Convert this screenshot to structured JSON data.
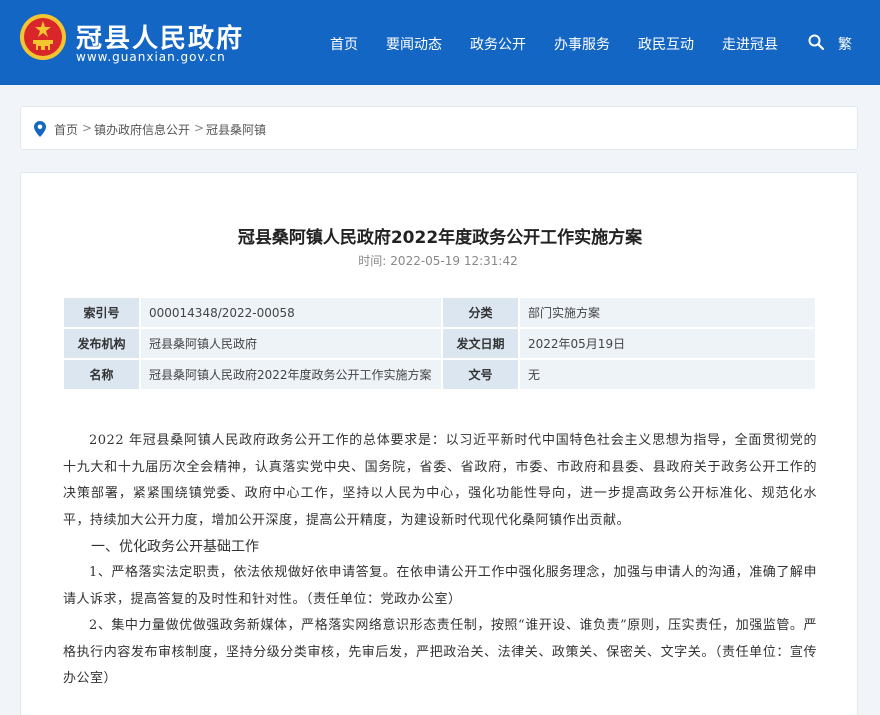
{
  "header": {
    "site_title": "冠县人民政府",
    "site_url": "www.guanxian.gov.cn",
    "nav": [
      "首页",
      "要闻动态",
      "政务公开",
      "办事服务",
      "政民互动",
      "走进冠县"
    ],
    "lang_switch": "繁"
  },
  "breadcrumb": {
    "items": [
      "首页",
      "镇办政府信息公开",
      "冠县桑阿镇"
    ],
    "separator": ">"
  },
  "article": {
    "title": "冠县桑阿镇人民政府2022年度政务公开工作实施方案",
    "time_label": "时间:",
    "time_value": "2022-05-19 12:31:42",
    "meta": {
      "index_label": "索引号",
      "index_value": "000014348/2022-00058",
      "category_label": "分类",
      "category_value": "部门实施方案",
      "issuer_label": "发布机构",
      "issuer_value": "冠县桑阿镇人民政府",
      "date_label": "发文日期",
      "date_value": "2022年05月19日",
      "name_label": "名称",
      "name_value": "冠县桑阿镇人民政府2022年度政务公开工作实施方案",
      "docno_label": "文号",
      "docno_value": "无"
    },
    "paragraphs": {
      "intro": "2022 年冠县桑阿镇人民政府政务公开工作的总体要求是：以习近平新时代中国特色社会主义思想为指导，全面贯彻党的十九大和十九届历次全会精神，认真落实党中央、国务院，省委、省政府，市委、市政府和县委、县政府关于政务公开工作的决策部署，紧紧围绕镇党委、政府中心工作，坚持以人民为中心，强化功能性导向，进一步提高政务公开标准化、规范化水平，持续加大公开力度，增加公开深度，提高公开精度，为建设新时代现代化桑阿镇作出贡献。",
      "section1": "一、优化政务公开基础工作",
      "item1": "1、严格落实法定职责，依法依规做好依申请答复。在依申请公开工作中强化服务理念，加强与申请人的沟通，准确了解申请人诉求，提高答复的及时性和针对性。（责任单位：党政办公室）",
      "item2": "2、集中力量做优做强政务新媒体，严格落实网络意识形态责任制，按照“谁开设、谁负责”原则，压实责任，加强监管。严格执行内容发布审核制度，坚持分级分类审核，先审后发，严把政治关、法律关、政策关、保密关、文字关。（责任单位：宣传办公室）"
    }
  },
  "colors": {
    "header_bg": "#1466c4",
    "page_bg": "#f1f5fa",
    "meta_key_bg": "#dbe6f1",
    "meta_val_bg": "#eef3f8"
  }
}
